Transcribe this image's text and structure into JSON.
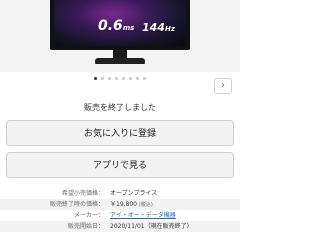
{
  "hero": {
    "spec_response": "0.6",
    "spec_response_unit": "ms",
    "spec_refresh": "144",
    "spec_refresh_unit": "Hz"
  },
  "carousel": {
    "dot_count": 8,
    "active_index": 0,
    "next_icon": "chevron-right-icon"
  },
  "status_text": "販売を終了しました",
  "buttons": {
    "favorite_label": "お気に入りに登録",
    "app_label": "アプリで見る"
  },
  "specs": [
    {
      "label": "希望小売価格：",
      "value": "オープンプライス",
      "small": ""
    },
    {
      "label": "販売終了時の価格：",
      "value": "￥19,800",
      "small": "(税込)"
    },
    {
      "label": "メーカー：",
      "value": "アイ・オー・データ機器",
      "small": ""
    },
    {
      "label": "販売開始日：",
      "value": "2020/11/01（現在販売終了）",
      "small": ""
    }
  ],
  "colors": {
    "link": "#2a66c8",
    "button_bg": "#f2f2f2"
  }
}
